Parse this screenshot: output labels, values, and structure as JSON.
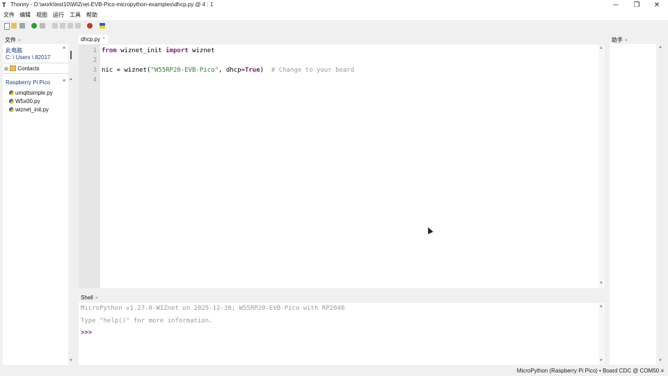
{
  "window": {
    "app_logo": "T",
    "title": "Thonny  -  D:\\work\\test10\\WIZnet-EVB-Pico-micropython-examples\\dhcp.py  @  4 : 1",
    "minimize": "─",
    "maximize": "❐",
    "close": "✕"
  },
  "menu": [
    "文件",
    "编辑",
    "视图",
    "运行",
    "工具",
    "帮助"
  ],
  "files_panel": {
    "tab_label": "文件",
    "local_heading": "此电脑",
    "local_path": "C: \\ Users \\ 82017",
    "local_items": [
      {
        "label": "Contacts",
        "type": "folder"
      }
    ],
    "device_heading": "Raspberry Pi Pico",
    "device_items": [
      {
        "label": "umqttsimple.py",
        "type": "py"
      },
      {
        "label": "W5x00.py",
        "type": "py"
      },
      {
        "label": "wiznet_init.py",
        "type": "py"
      }
    ]
  },
  "editor": {
    "tab_label": "dhcp.py",
    "line_numbers": [
      "1",
      "2",
      "3",
      "4"
    ],
    "line1": {
      "kw1": "from",
      "mod": " wiznet_init ",
      "kw2": "import",
      "name": " wiznet"
    },
    "line3": {
      "pre": "nic = wiznet(",
      "str": "\"W55RP20-EVB-Pico\"",
      "mid": ", dhcp=",
      "kwc": "True",
      "post": ")",
      "comment": "  # Change to your board"
    }
  },
  "shell": {
    "tab_label": "Shell",
    "lines": [
      "MicroPython v1.27.0-WIZnet on 2025-12-30; W55RP20-EVB-Pico with RP2040",
      "Type \"help()\" for more information."
    ],
    "prompt": ">>>"
  },
  "assistant": {
    "tab_label": "助手"
  },
  "status": {
    "text": "MicroPython (Raspberry Pi Pico)  •  Board CDC @ COM50  ≡"
  },
  "colors": {
    "keyword": "#7a1a7a",
    "string": "#2e7d32",
    "comment": "#999999",
    "prompt": "#7a1a7a"
  }
}
